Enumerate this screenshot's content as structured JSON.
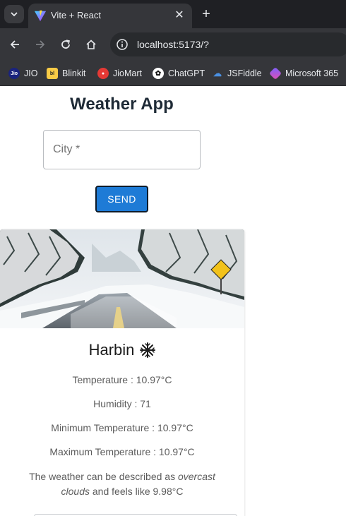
{
  "browser": {
    "tab_title": "Vite + React",
    "url": "localhost:5173/?",
    "bookmarks": [
      {
        "label": "JIO",
        "icon": "jio-icon",
        "color": "#1a237e"
      },
      {
        "label": "Blinkit",
        "icon": "blinkit-icon",
        "color": "#f8cb46"
      },
      {
        "label": "JioMart",
        "icon": "jiomart-icon",
        "color": "#e53935"
      },
      {
        "label": "ChatGPT",
        "icon": "chatgpt-icon",
        "color": "#ffffff"
      },
      {
        "label": "JSFiddle",
        "icon": "jsfiddle-icon",
        "color": "#4a90e2"
      },
      {
        "label": "Microsoft 365",
        "icon": "microsoft365-icon",
        "color": "#7b61ff"
      }
    ]
  },
  "app": {
    "title": "Weather App",
    "city_placeholder": "City *",
    "send_label": "SEND",
    "accent_color": "#1e7bd6"
  },
  "weather": {
    "city": "Harbin",
    "icon": "snowflake-icon",
    "temperature": "Temperature : 10.97°C",
    "humidity": "Humidity : 71",
    "min_temp": "Minimum Temperature : 10.97°C",
    "max_temp": "Maximum Temperature : 10.97°C",
    "desc_prefix": "The weather can be described as ",
    "desc_condition": "overcast clouds",
    "desc_suffix": " and feels like 9.98°C"
  }
}
